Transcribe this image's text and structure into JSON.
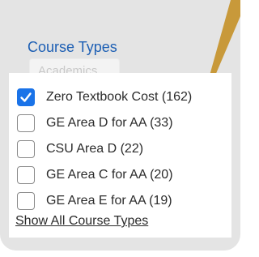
{
  "colors": {
    "title": "#1d5fb4",
    "accent_checkbox": "#1a73e8",
    "panel_background": "#e4e4e4",
    "wedge": "#c8993a"
  },
  "filter": {
    "title": "Course Types",
    "ghost_tab_label": "Academics",
    "options": [
      {
        "label": "Zero Textbook Cost (162)",
        "checked": true
      },
      {
        "label": "GE Area D for AA (33)",
        "checked": false
      },
      {
        "label": "CSU Area D (22)",
        "checked": false
      },
      {
        "label": "GE Area C for AA (20)",
        "checked": false
      },
      {
        "label": "GE Area E for AA (19)",
        "checked": false
      }
    ],
    "show_all_label": "Show All Course Types"
  }
}
